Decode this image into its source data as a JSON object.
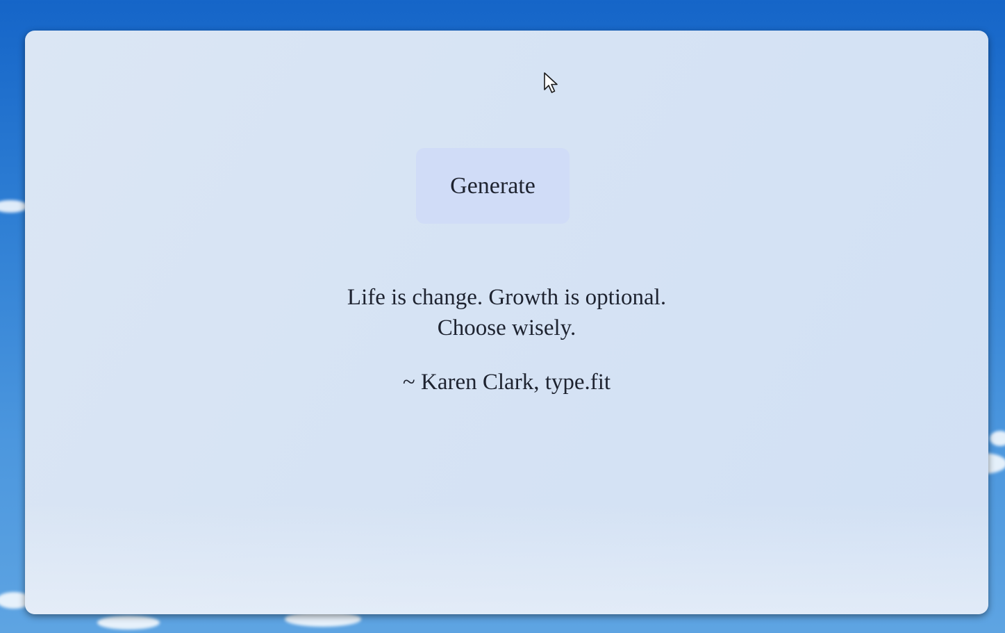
{
  "colors": {
    "sky": "#2f7fd4",
    "card_background": "#d6e3f4",
    "button_background": "#d0dcf7",
    "text": "#1e2330"
  },
  "generator": {
    "button_label": "Generate"
  },
  "quote": {
    "text": "Life is change. Growth is optional. Choose wisely.",
    "attribution": "~ Karen Clark, type.fit"
  },
  "cursor": {
    "icon": "arrow-cursor-icon"
  }
}
